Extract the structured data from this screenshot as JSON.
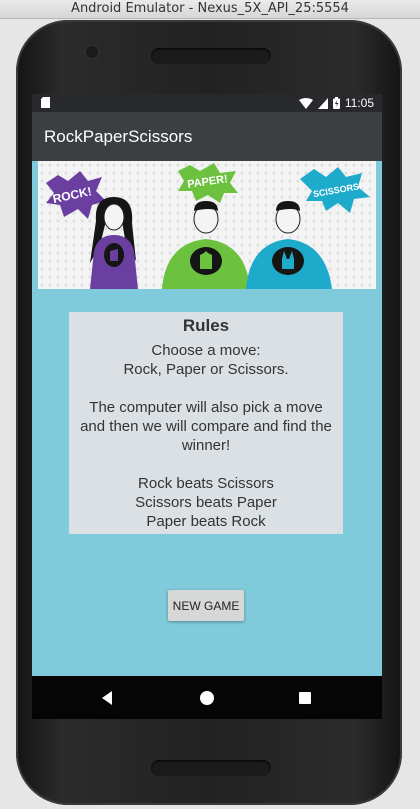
{
  "window": {
    "title": "Android Emulator - Nexus_5X_API_25:5554"
  },
  "status_bar": {
    "time": "11:05"
  },
  "app_bar": {
    "title": "RockPaperScissors"
  },
  "banner": {
    "bubble_rock": "ROCK!",
    "bubble_paper": "PAPER!",
    "bubble_scissors": "SCISSORS!"
  },
  "rules": {
    "title": "Rules",
    "line1": "Choose a move:",
    "line2": "Rock, Paper or Scissors.",
    "line3": "The computer will also pick a move",
    "line4": "and then we will compare and find the",
    "line5": "winner!",
    "line6": "Rock beats Scissors",
    "line7": "Scissors beats Paper",
    "line8": "Paper beats Rock"
  },
  "new_game_button": {
    "label": "NEW GAME"
  },
  "colors": {
    "screen_bg": "#80cbdb",
    "app_bar": "#3c3f41",
    "status_bar": "#27292d",
    "rules_bg": "#dbe0e4",
    "rock": "#6b3fa0",
    "paper": "#6cc23f",
    "scissors": "#1eaacb"
  },
  "icons": [
    "sd-card-icon",
    "wifi-icon",
    "signal-icon",
    "battery-icon",
    "back-icon",
    "home-icon",
    "recents-icon"
  ]
}
